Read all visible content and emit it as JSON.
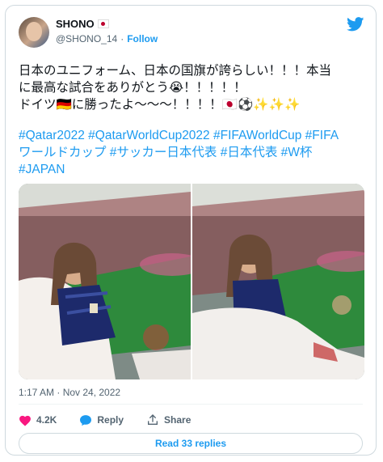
{
  "author": {
    "display_name": "SHONO",
    "handle": "@SHONO_14",
    "separator": "·",
    "follow_label": "Follow"
  },
  "tweet": {
    "line1": "日本のユニフォーム、日本の国旗が誇らしい！！！本当",
    "line2": "に最高な試合をありがとう😭！！！！！",
    "line3": "ドイツ🇩🇪に勝ったよ〜〜〜！！！！🇯🇵⚽✨✨✨",
    "hashtags_line1": "#Qatar2022 #QatarWorldCup2022 #FIFAWorldCup #FIFA",
    "hashtags_line2": "ワールドカップ #サッカー日本代表 #日本代表 #W杯",
    "hashtags_line3": "#JAPAN",
    "timestamp": "1:17 AM · Nov 24, 2022"
  },
  "actions": {
    "like_count": "4.2K",
    "reply_label": "Reply",
    "share_label": "Share",
    "read_replies_label": "Read 33 replies"
  },
  "colors": {
    "accent": "#1d9bf0",
    "like": "#f91880",
    "text": "#0f1419",
    "muted": "#536471"
  },
  "icons": [
    "twitter-bird-icon",
    "heart-icon",
    "reply-bubble-icon",
    "share-icon",
    "japan-flag-icon"
  ]
}
